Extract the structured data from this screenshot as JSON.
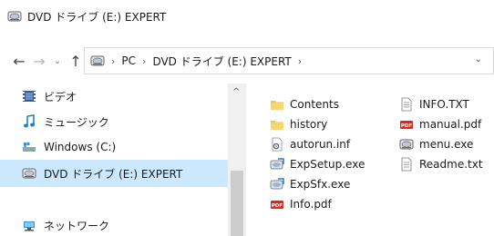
{
  "window": {
    "title": "DVD ドライブ (E:) EXPERT",
    "icon": "dvd-drive-icon"
  },
  "nav_buttons": {
    "back": "←",
    "forward": "→",
    "recent": "⌄",
    "up": "↑"
  },
  "address": {
    "icon": "dvd-drive-icon",
    "separator": "›",
    "crumbs": [
      "PC",
      "DVD ドライブ (E:) EXPERT"
    ],
    "dropdown": "⌄"
  },
  "sidebar": {
    "items": [
      {
        "label": "ビデオ",
        "icon": "video-icon"
      },
      {
        "label": "ミュージック",
        "icon": "music-icon"
      },
      {
        "label": "Windows (C:)",
        "icon": "windows-drive-icon"
      },
      {
        "label": "DVD ドライブ (E:) EXPERT",
        "icon": "dvd-drive-icon",
        "selected": true
      },
      {
        "label": "ネットワーク",
        "icon": "network-icon"
      }
    ]
  },
  "scrollbar": {
    "up_arrow": "^"
  },
  "files": {
    "column1": [
      {
        "name": "Contents",
        "icon": "folder-icon"
      },
      {
        "name": "history",
        "icon": "folder-icon"
      },
      {
        "name": "autorun.inf",
        "icon": "settings-file-icon"
      },
      {
        "name": "ExpSetup.exe",
        "icon": "setup-exe-icon"
      },
      {
        "name": "ExpSfx.exe",
        "icon": "setup-exe-icon"
      },
      {
        "name": "Info.pdf",
        "icon": "pdf-icon"
      }
    ],
    "column2": [
      {
        "name": "INFO.TXT",
        "icon": "text-file-icon"
      },
      {
        "name": "manual.pdf",
        "icon": "pdf-icon"
      },
      {
        "name": "menu.exe",
        "icon": "dvd-exe-icon"
      },
      {
        "name": "Readme.txt",
        "icon": "text-file-icon"
      }
    ]
  },
  "colors": {
    "selection": "#cce8ff",
    "folder": "#f2c94c",
    "pdf": "#d42b1e"
  }
}
